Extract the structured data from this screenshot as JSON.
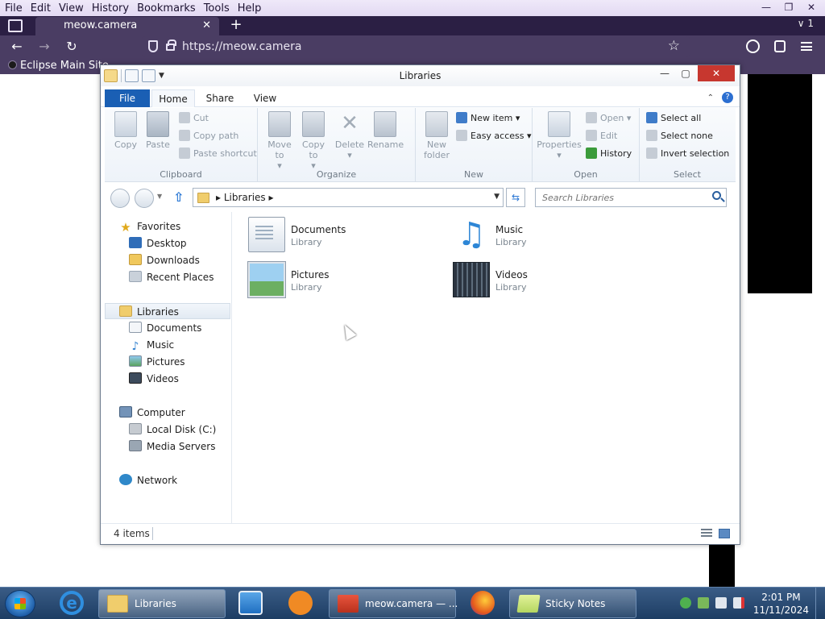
{
  "browser": {
    "menu": [
      "File",
      "Edit",
      "View",
      "History",
      "Bookmarks",
      "Tools",
      "Help"
    ],
    "window_controls": {
      "minimize": "—",
      "restore": "❐",
      "close": "✕"
    },
    "tab": {
      "title": "meow.camera",
      "close": "✕"
    },
    "new_tab": "+",
    "all_tabs": "∨ 1",
    "nav": {
      "back": "←",
      "forward": "→",
      "reload": "↻"
    },
    "url": "https://meow.camera",
    "bookmark_star": "☆",
    "toolbar_icons": [
      "account-icon",
      "extensions-icon",
      "menu-icon"
    ],
    "bookmarks": [
      {
        "label": "Eclipse Main Site"
      }
    ]
  },
  "explorer": {
    "title": "Libraries",
    "controls": {
      "minimize": "—",
      "maximize": "▢",
      "close": "✕"
    },
    "ribbon_tabs": [
      "File",
      "Home",
      "Share",
      "View"
    ],
    "ribbon": {
      "clipboard": {
        "copy": "Copy",
        "paste": "Paste",
        "cut": "Cut",
        "copy_path": "Copy path",
        "paste_shortcut": "Paste shortcut",
        "label": "Clipboard"
      },
      "organize": {
        "move_to": "Move to",
        "copy_to": "Copy to",
        "delete": "Delete",
        "rename": "Rename",
        "label": "Organize"
      },
      "new": {
        "new_folder": "New folder",
        "new_item": "New item",
        "easy_access": "Easy access",
        "label": "New"
      },
      "open": {
        "properties": "Properties",
        "open": "Open",
        "edit": "Edit",
        "history": "History",
        "label": "Open"
      },
      "select": {
        "select_all": "Select all",
        "select_none": "Select none",
        "invert_selection": "Invert selection",
        "label": "Select"
      }
    },
    "address": {
      "crumb": "Libraries"
    },
    "search": {
      "placeholder": "Search Libraries"
    },
    "nav_pane": {
      "favorites": "Favorites",
      "desktop": "Desktop",
      "downloads": "Downloads",
      "recent_places": "Recent Places",
      "libraries": "Libraries",
      "documents": "Documents",
      "music": "Music",
      "pictures": "Pictures",
      "videos": "Videos",
      "computer": "Computer",
      "local_disk": "Local Disk (C:)",
      "media_servers": "Media Servers",
      "network": "Network"
    },
    "libraries": [
      {
        "name": "Documents",
        "type": "Library",
        "icon": "documents-library-icon"
      },
      {
        "name": "Music",
        "type": "Library",
        "icon": "music-library-icon"
      },
      {
        "name": "Pictures",
        "type": "Library",
        "icon": "pictures-library-icon"
      },
      {
        "name": "Videos",
        "type": "Library",
        "icon": "videos-library-icon"
      }
    ],
    "status": {
      "count": "4 items"
    }
  },
  "taskbar": {
    "explorer_label": "Libraries",
    "firefox_window_label": "meow.camera — ...",
    "sticky_label": "Sticky Notes",
    "time": "2:01 PM",
    "date": "11/11/2024"
  }
}
